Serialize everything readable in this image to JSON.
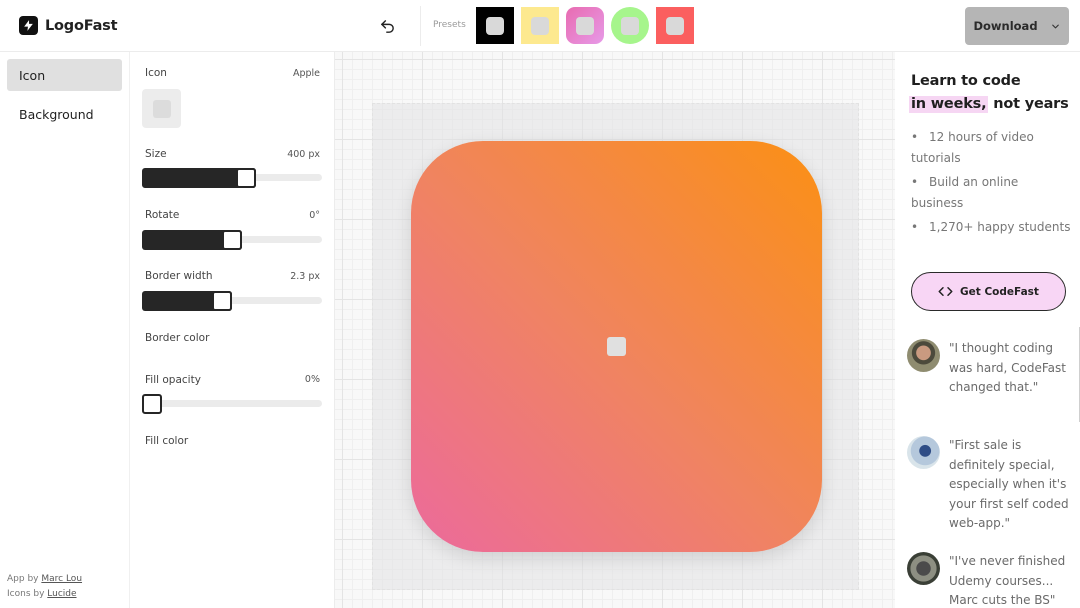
{
  "header": {
    "app_name": "LogoFast",
    "presets_label": "Presets",
    "presets": [
      {
        "name": "black-square",
        "bg": "#000000"
      },
      {
        "name": "yellow-square",
        "bg": "#fde98f"
      },
      {
        "name": "pink-rounded",
        "bg": "#e86bb0"
      },
      {
        "name": "green-circle",
        "bg": "#a6f58c"
      },
      {
        "name": "red-square",
        "bg": "#fb5f5f"
      }
    ],
    "download_label": "Download"
  },
  "nav": {
    "items": [
      {
        "label": "Icon",
        "active": true
      },
      {
        "label": "Background",
        "active": false
      }
    ],
    "credits": {
      "app_by": "App by",
      "app_author": "Marc Lou",
      "icons_by": "Icons by",
      "icons_source": "Lucide"
    }
  },
  "controls": {
    "icon": {
      "label": "Icon",
      "value": "Apple"
    },
    "size": {
      "label": "Size",
      "value": "400 px",
      "fraction": 0.59
    },
    "rotate": {
      "label": "Rotate",
      "value": "0°",
      "fraction": 0.5
    },
    "border_width": {
      "label": "Border width",
      "value": "2.3 px",
      "fraction": 0.44
    },
    "border_color": {
      "label": "Border color"
    },
    "fill_opacity": {
      "label": "Fill opacity",
      "value": "0%",
      "fraction": 0.0
    },
    "fill_color": {
      "label": "Fill color"
    }
  },
  "canvas": {
    "gradient_colors": [
      "#ec6a9c",
      "#f08460",
      "#fb9014"
    ]
  },
  "promo": {
    "title_line1": "Learn to code",
    "title_highlight": "in weeks,",
    "title_rest": "not years",
    "bullets": [
      "12 hours of video tutorials",
      "Build an online business",
      "1,270+ happy students"
    ],
    "cta_label": "Get CodeFast",
    "testimonials": [
      {
        "quote": "\"I thought coding was hard, CodeFast changed that.\""
      },
      {
        "quote": "\"First sale is definitely special, especially when it's your first self coded web-app.\""
      },
      {
        "quote": "\"I've never finished Udemy courses... Marc cuts the BS\""
      }
    ]
  }
}
